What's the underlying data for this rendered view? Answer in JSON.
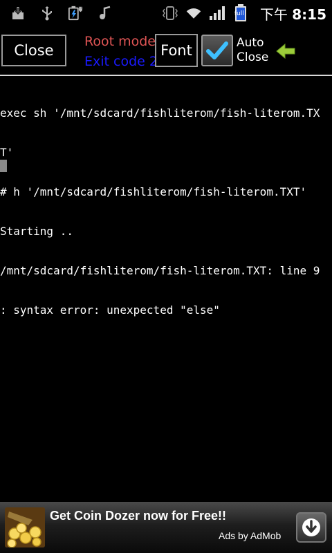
{
  "statusbar": {
    "left_icons": [
      "download-icon",
      "usb-icon",
      "battery-charging-icon",
      "music-icon"
    ],
    "right_icons": [
      "vibrate-icon",
      "wifi-icon",
      "signal-icon",
      "battery-full-icon"
    ],
    "battery_label": "full",
    "time_prefix": "下午",
    "time": "8:15"
  },
  "toolbar": {
    "close_label": "Close",
    "root_mode_label": "Root mode",
    "exit_code_label": "Exit code 2",
    "font_label": "Font",
    "auto_close_line1": "Auto",
    "auto_close_line2": "Close",
    "auto_close_checked": true,
    "colors": {
      "root_mode": "#e05555",
      "exit_code": "#1a1aff",
      "check": "#3ec0ff",
      "arrow": "#9ccc3a"
    }
  },
  "terminal": {
    "lines": [
      "exec sh '/mnt/sdcard/fishliterom/fish-literom.TX",
      "T'",
      "# h '/mnt/sdcard/fishliterom/fish-literom.TXT'",
      "Starting ..",
      "/mnt/sdcard/fishliterom/fish-literom.TXT: line 9",
      ": syntax error: unexpected \"else\""
    ]
  },
  "ad": {
    "title": "Get Coin Dozer now for Free!!",
    "by": "Ads by AdMob",
    "thumb_icon": "coin-dozer-icon",
    "download_icon": "download-arrow-icon"
  }
}
